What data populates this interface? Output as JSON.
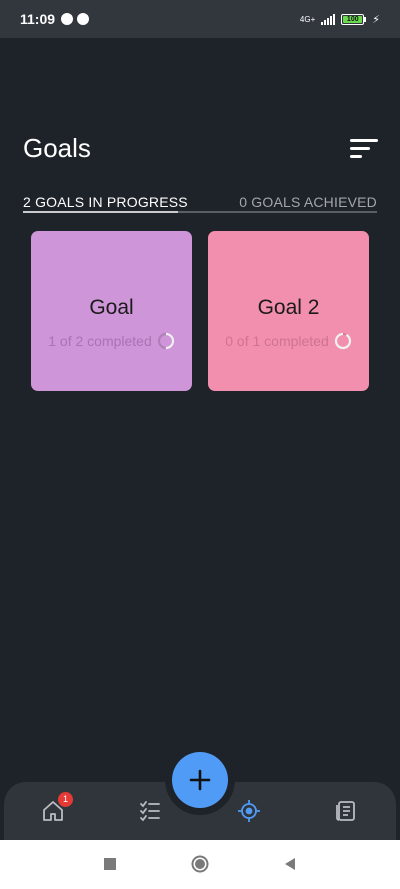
{
  "status_bar": {
    "time": "11:09",
    "network": "4G+",
    "battery": "100",
    "icons": [
      "app-icon",
      "app-icon",
      "signal-icon",
      "battery-icon",
      "charging-icon"
    ]
  },
  "header": {
    "title": "Goals",
    "sort_icon": "sort-icon"
  },
  "tabs": {
    "in_progress": "2 GOALS IN PROGRESS",
    "achieved": "0 GOALS ACHIEVED"
  },
  "goals": [
    {
      "title": "Goal",
      "progress_text": "1 of 2 completed",
      "progress": 0.5,
      "color": "#cf95d9"
    },
    {
      "title": "Goal 2",
      "progress_text": "0 of 1 completed",
      "progress": 0.0,
      "color": "#f28fae"
    }
  ],
  "bottom_nav": {
    "items": [
      "home-icon",
      "checklist-icon",
      "target-icon",
      "journal-icon"
    ],
    "active": "target-icon",
    "home_badge": "1",
    "fab_icon": "plus-icon"
  },
  "system_nav": [
    "square-icon",
    "circle-icon",
    "back-triangle-icon"
  ],
  "colors": {
    "background": "#1e2229",
    "accent": "#4f9bf6",
    "badge": "#e53935"
  }
}
